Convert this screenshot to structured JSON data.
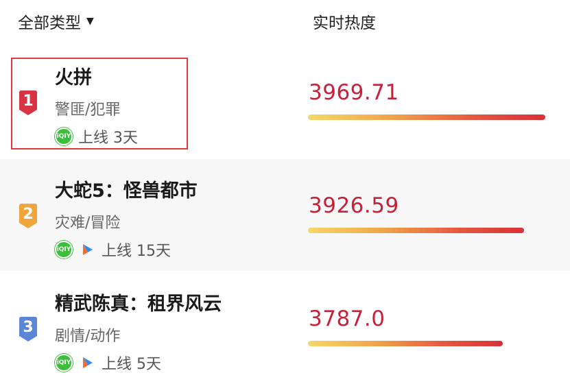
{
  "header": {
    "filter_label": "全部类型",
    "filter_caret": "▼",
    "heat_label": "实时热度"
  },
  "rows": [
    {
      "rank": "1",
      "title": "火拼",
      "genre": "警匪/犯罪",
      "platforms": [
        "iqiyi-icon"
      ],
      "online": "上线 3天",
      "heat": "3969.71",
      "heat_fraction": 1.0,
      "badge_color": "#d93444"
    },
    {
      "rank": "2",
      "title": "大蛇5：怪兽都市",
      "genre": "灾难/冒险",
      "platforms": [
        "iqiyi-icon",
        "youku-play-icon"
      ],
      "online": "上线 15天",
      "heat": "3926.59",
      "heat_fraction": 0.91,
      "badge_color": "#f0a43c"
    },
    {
      "rank": "3",
      "title": "精武陈真：租界风云",
      "genre": "剧情/动作",
      "platforms": [
        "iqiyi-icon",
        "youku-play-icon"
      ],
      "online": "上线 5天",
      "heat": "3787.0",
      "heat_fraction": 0.82,
      "badge_color": "#5b86d6"
    }
  ],
  "icons": {
    "iqiyi_text": "iQIY"
  },
  "colors": {
    "heat_text": "#c4223a",
    "highlight_border": "#e0383c",
    "bar_start": "#f5d769",
    "bar_end": "#d8303a"
  }
}
